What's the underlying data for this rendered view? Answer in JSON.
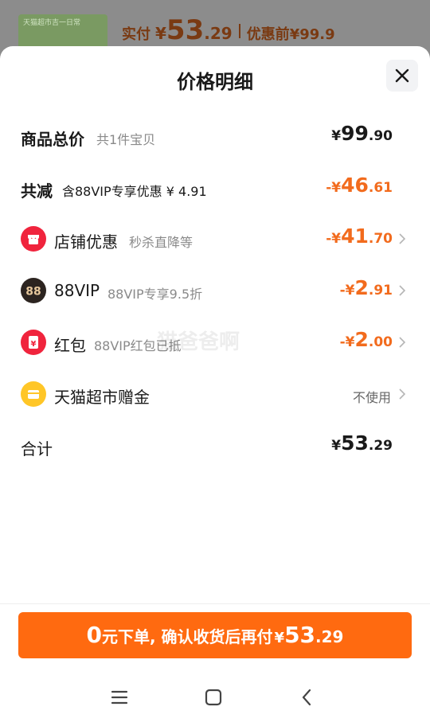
{
  "under": {
    "thumb_text": "天猫超市吉一日常",
    "paid_label": "实付",
    "currency": "¥",
    "paid_int": "53",
    "paid_dec": ".29",
    "orig_label": "优惠前",
    "orig_value": "¥99.9"
  },
  "sheet": {
    "title": "价格明细",
    "close_icon": "close-icon"
  },
  "rows": {
    "total": {
      "label": "商品总价",
      "sub": "共1件宝贝",
      "currency": "¥",
      "int": "99",
      "dec": ".90"
    },
    "reduce": {
      "label": "共减",
      "sub": "含88VIP专享优惠 ¥ 4.91",
      "currency": "-¥",
      "int": "46",
      "dec": ".61"
    },
    "shop": {
      "icon": "shop-icon",
      "label": "店铺优惠",
      "sub": "秒杀直降等",
      "currency": "-¥",
      "int": "41",
      "dec": ".70"
    },
    "vip": {
      "icon": "88vip-icon",
      "icon_text": "88",
      "label": "88VIP",
      "sub": "88VIP专享9.5折",
      "currency": "-¥",
      "int": "2",
      "dec": ".91"
    },
    "hongbao": {
      "icon": "red-packet-icon",
      "icon_text": "¥",
      "label": "红包",
      "sub": "88VIP红包已抵",
      "currency": "-¥",
      "int": "2",
      "dec": ".00"
    },
    "tmall": {
      "icon": "tmall-gift-icon",
      "label": "天猫超市赠金",
      "value": "不使用"
    },
    "sum": {
      "label": "合计",
      "currency": "¥",
      "int": "53",
      "dec": ".29"
    }
  },
  "watermark": "猫爸爸啊",
  "pay_button": {
    "zero": "0",
    "text": "元下单, 确认收货后再付",
    "currency": "¥",
    "int": "53",
    "dec": ".29"
  },
  "navbar": {
    "menu_icon": "menu-icon",
    "home_icon": "home-icon",
    "back_icon": "back-icon"
  },
  "colors": {
    "accent": "#ff6a10",
    "discount": "#f26b1d",
    "red": "#f0243d",
    "gold": "#ffc627"
  }
}
